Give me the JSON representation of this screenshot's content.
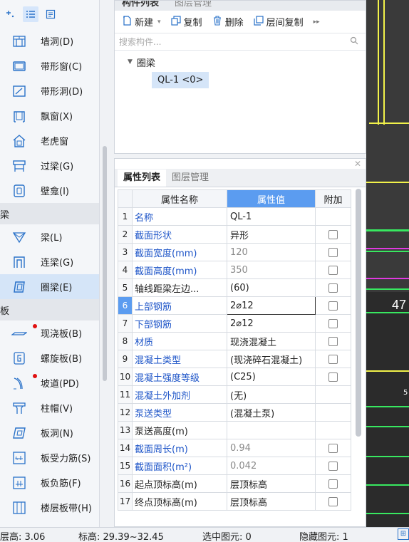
{
  "nav": {
    "items_top": [
      {
        "label": "墙洞(D)"
      },
      {
        "label": "带形窗(C)"
      },
      {
        "label": "带形洞(D)"
      },
      {
        "label": "飘窗(X)"
      },
      {
        "label": "老虎窗"
      },
      {
        "label": "过梁(G)"
      },
      {
        "label": "壁龛(I)"
      }
    ],
    "cat_beam": "梁",
    "items_beam": [
      {
        "label": "梁(L)"
      },
      {
        "label": "连梁(G)"
      },
      {
        "label": "圈梁(E)"
      }
    ],
    "cat_slab": "板",
    "items_slab": [
      {
        "label": "现浇板(B)"
      },
      {
        "label": "螺旋板(B)"
      },
      {
        "label": "坡道(PD)"
      },
      {
        "label": "柱帽(V)"
      },
      {
        "label": "板洞(N)"
      },
      {
        "label": "板受力筋(S)"
      },
      {
        "label": "板负筋(F)"
      },
      {
        "label": "楼层板带(H)"
      }
    ]
  },
  "complist": {
    "tab_list": "构件列表",
    "tab_layer": "图层管理",
    "toolbar": {
      "new": "新建",
      "copy": "复制",
      "delete": "删除",
      "floor_copy": "层间复制"
    },
    "search_placeholder": "搜索构件...",
    "tree": {
      "group": "圈梁",
      "item": "QL-1 <0>"
    }
  },
  "props": {
    "tab_props": "属性列表",
    "tab_layer": "图层管理",
    "col_name": "属性名称",
    "col_value": "属性值",
    "col_extra": "附加",
    "rows": [
      {
        "n": "1",
        "name": "名称",
        "value": "QL-1",
        "name_blue": true,
        "value_grey": false,
        "checkbox": false
      },
      {
        "n": "2",
        "name": "截面形状",
        "value": "异形",
        "name_blue": true,
        "value_grey": false,
        "checkbox": true
      },
      {
        "n": "3",
        "name": "截面宽度(mm)",
        "value": "120",
        "name_blue": true,
        "value_grey": true,
        "checkbox": true
      },
      {
        "n": "4",
        "name": "截面高度(mm)",
        "value": "350",
        "name_blue": true,
        "value_grey": true,
        "checkbox": true
      },
      {
        "n": "5",
        "name": "轴线距梁左边...",
        "value": "(60)",
        "name_blue": false,
        "value_grey": false,
        "checkbox": true
      },
      {
        "n": "6",
        "name": "上部钢筋",
        "value": "2⌀12",
        "name_blue": true,
        "value_grey": false,
        "checkbox": true,
        "selected": true
      },
      {
        "n": "7",
        "name": "下部钢筋",
        "value": "2⌀12",
        "name_blue": true,
        "value_grey": false,
        "checkbox": true
      },
      {
        "n": "8",
        "name": "材质",
        "value": "现浇混凝土",
        "name_blue": true,
        "value_grey": false,
        "checkbox": true
      },
      {
        "n": "9",
        "name": "混凝土类型",
        "value": "(现浇碎石混凝土)",
        "name_blue": true,
        "value_grey": false,
        "checkbox": true
      },
      {
        "n": "10",
        "name": "混凝土强度等级",
        "value": "(C25)",
        "name_blue": true,
        "value_grey": false,
        "checkbox": true
      },
      {
        "n": "11",
        "name": "混凝土外加剂",
        "value": "(无)",
        "name_blue": true,
        "value_grey": false,
        "checkbox": false
      },
      {
        "n": "12",
        "name": "泵送类型",
        "value": "(混凝土泵)",
        "name_blue": true,
        "value_grey": false,
        "checkbox": false
      },
      {
        "n": "13",
        "name": "泵送高度(m)",
        "value": "",
        "name_blue": false,
        "value_grey": false,
        "checkbox": false
      },
      {
        "n": "14",
        "name": "截面周长(m)",
        "value": "0.94",
        "name_blue": true,
        "value_grey": true,
        "checkbox": true
      },
      {
        "n": "15",
        "name": "截面面积(m²)",
        "value": "0.042",
        "name_blue": true,
        "value_grey": true,
        "checkbox": true
      },
      {
        "n": "16",
        "name": "起点顶标高(m)",
        "value": "层顶标高",
        "name_blue": false,
        "value_grey": false,
        "checkbox": true
      },
      {
        "n": "17",
        "name": "终点顶标高(m)",
        "value": "层顶标高",
        "name_blue": false,
        "value_grey": false,
        "checkbox": true
      }
    ]
  },
  "canvas": {
    "label_47": "47",
    "label_5": "5"
  },
  "status": {
    "floor_height": "层高:  3.06",
    "elevation": "标高:  29.39~32.45",
    "selected": "选中图元: 0",
    "hidden": "隐藏图元: 1"
  },
  "colors": {
    "accent": "#5b9cf0",
    "selected_bg": "#d5e5f8",
    "link_blue": "#1e55c8",
    "canvas_bg": "#2b2b2b",
    "red_dot": "#e01010"
  }
}
